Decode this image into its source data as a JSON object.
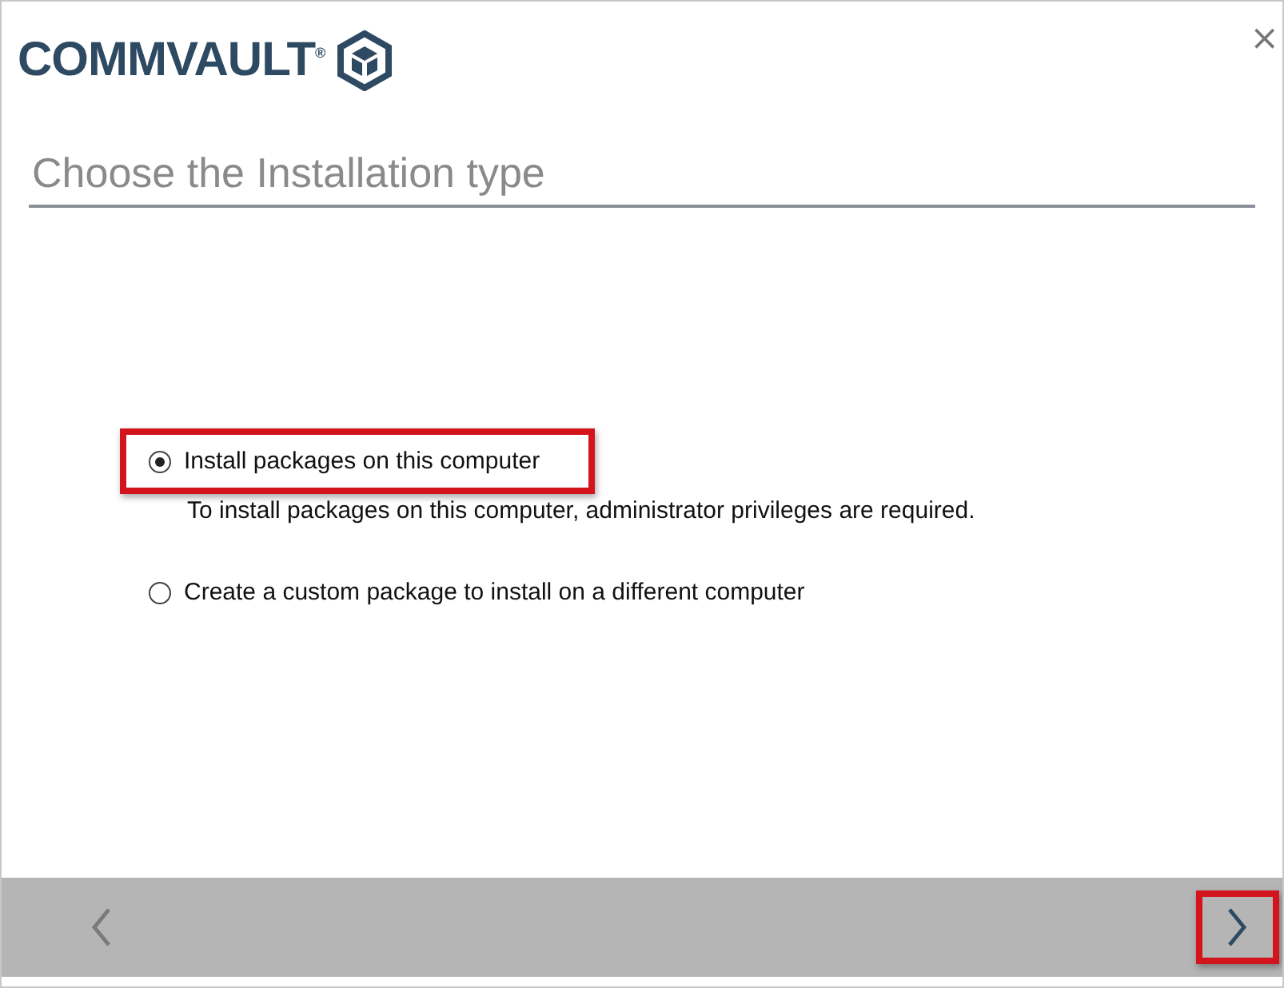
{
  "logo": {
    "text": "COMMVAULT$^{®}$"
  },
  "close": {
    "label": "×"
  },
  "title": "Choose the Installation type",
  "options": [
    {
      "label": "Install packages on this computer",
      "selected": true,
      "highlighted": true,
      "description": "To install packages on this computer, administrator privileges are required."
    },
    {
      "label": "Create a custom package to install on a different computer",
      "selected": false,
      "highlighted": false
    }
  ],
  "nav": {
    "back": {
      "disabled": true,
      "highlighted": false
    },
    "next": {
      "disabled": false,
      "highlighted": true
    }
  }
}
